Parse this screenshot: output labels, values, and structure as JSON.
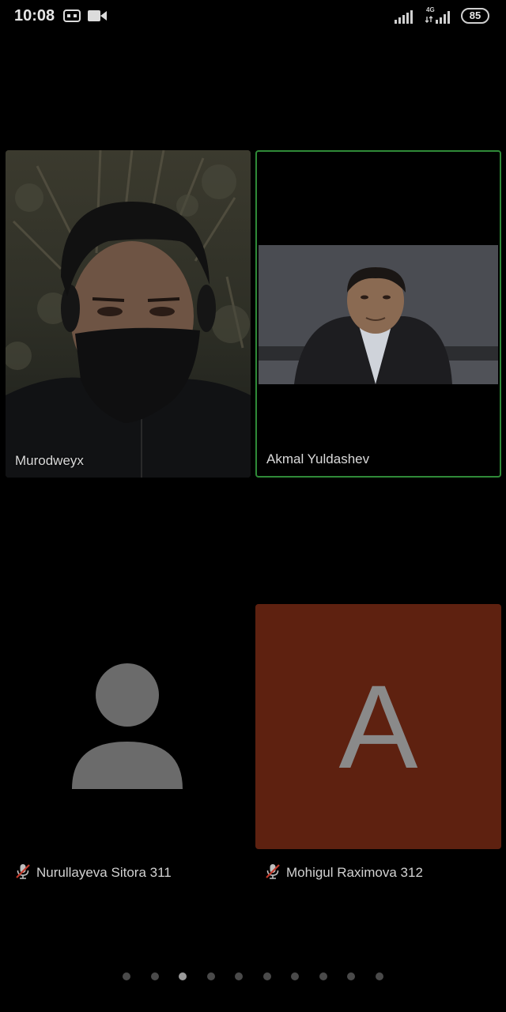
{
  "status_bar": {
    "time": "10:08",
    "network_type": "4G",
    "battery_level": "85",
    "icons": [
      "vr-icon",
      "video-camera-icon",
      "signal-icon",
      "signal-4g-icon",
      "battery-icon"
    ]
  },
  "participants": [
    {
      "name": "Murodweyx",
      "video": "on",
      "active_speaker": false
    },
    {
      "name": "Akmal Yuldashev",
      "video": "on",
      "active_speaker": true,
      "highlight_color": "#2f8a38"
    },
    {
      "name": "Nurullayeva Sitora 311",
      "video": "off",
      "muted": true,
      "avatar": "person-silhouette-icon"
    },
    {
      "name": "Mohigul Raximova 312",
      "video": "off",
      "muted": true,
      "avatar_letter": "A",
      "avatar_color": "#5e2110"
    }
  ],
  "pager": {
    "total_pages": 10,
    "current_page": 3
  }
}
